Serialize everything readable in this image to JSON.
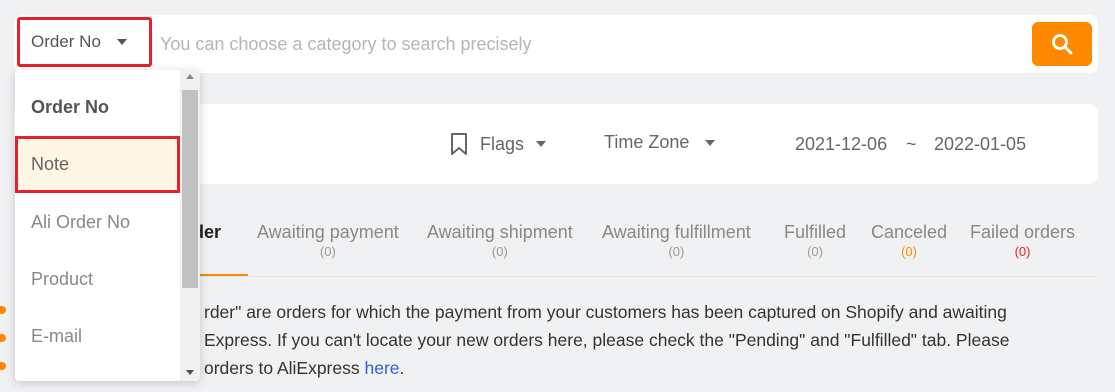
{
  "search": {
    "category_label": "Order No",
    "placeholder": "You can choose a category to search precisely"
  },
  "filters": {
    "flags_label": "Flags",
    "timezone_label": "Time Zone",
    "date_start": "2021-12-06",
    "date_separator": "~",
    "date_end": "2022-01-05"
  },
  "tabs": [
    {
      "label": "rder",
      "count": ""
    },
    {
      "label": "Awaiting payment",
      "count": "(0)"
    },
    {
      "label": "Awaiting shipment",
      "count": "(0)"
    },
    {
      "label": "Awaiting fulfillment",
      "count": "(0)"
    },
    {
      "label": "Fulfilled",
      "count": "(0)"
    },
    {
      "label": "Canceled",
      "count": "(0)"
    },
    {
      "label": "Failed orders",
      "count": "(0)"
    }
  ],
  "description": {
    "line1": "rder\" are orders for which the payment from your customers has been captured on Shopify and awaiting",
    "line2": "Express. If you can't locate your new orders here, please check the \"Pending\" and \"Fulfilled\" tab. Please",
    "line3_prefix": "orders to AliExpress ",
    "link_text": "here",
    "line3_suffix": "."
  },
  "dropdown": {
    "items": [
      "Order No",
      "Note",
      "Ali Order No",
      "Product",
      "E-mail"
    ]
  },
  "colors": {
    "accent": "#ff8a00",
    "highlight_border": "#e8202a",
    "link": "#3a5bd9"
  }
}
